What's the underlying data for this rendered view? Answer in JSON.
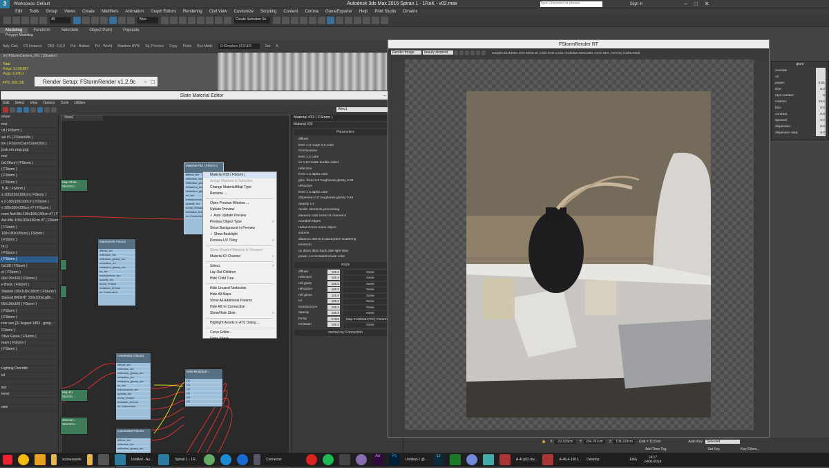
{
  "titlebar": {
    "logo": "3",
    "workspace": "Workspace: Default",
    "title": "Autodesk 3ds Max 2016    Spiran 1 - 1RoK - v02.max",
    "search_placeholder": "Type a keyword or phrase",
    "signin": "Sign In"
  },
  "menu": [
    "Edit",
    "Tools",
    "Group",
    "Views",
    "Create",
    "Modifiers",
    "Animation",
    "Graph Editors",
    "Rendering",
    "Civil View",
    "Customize",
    "Scripting",
    "Content",
    "Corona",
    "GameExporter",
    "Help",
    "Print Studio",
    "Omatrix"
  ],
  "toolbar": {
    "selection_filter": "All",
    "view": "View",
    "named_set": "Create Selection Se"
  },
  "ribbon": {
    "tabs": [
      "Modeling",
      "Freeform",
      "Selection",
      "Object Paint",
      "Populate"
    ],
    "sub": "Polygon Modeling"
  },
  "subtool": [
    "Aply. Calc",
    "FS Instance",
    "OBJ - 0,0,0",
    "Pvt - Bottom",
    "Pvt - World",
    "Random UVW",
    "Sq. Preview",
    "Copy",
    "Paste",
    "Box Mode",
    "D:\\Dropbox (ICI)\\3D\\",
    "Set",
    "A"
  ],
  "viewport": {
    "label": "[+] [FStormCamera_001 ] [Shaded ]",
    "total": "Total",
    "polys": "Polys:  3,169,857",
    "verts": "Verts:  2,470,1",
    "fps": "FPS:    109.168"
  },
  "render_setup": {
    "title": "Render Setup: FStormRender v1.2.9c"
  },
  "slate": {
    "title": "Slate Material Editor",
    "menu": [
      "Edit",
      "Select",
      "View",
      "Options",
      "Tools",
      "Utilities"
    ],
    "view_select": "View1",
    "view_tab": "View1",
    "browser_title": "owser",
    "browser_items": [
      "mat",
      "ult ( FStorm )",
      "set #1 ( FStormMix )",
      "ion ( FStormColorCorrection )",
      "[oak.mix.map.jpg]",
      "mat",
      "0x100cm) ( FStorm )",
      "( FStorm )",
      "( FStorm )",
      "( FStorm )",
      "TUR ( FStorm )",
      "a 100x100x100cm ( FStorm )",
      "x 2 100x100x100cm ( FStorm )",
      "x 100x100x100cm #7 ( FStorm )",
      "rown Ash Mix 100x100x100cm #7 ( FStorm )",
      "Ash Mix 100x100x100cm #7 ( FStorm )",
      "( FStorm )",
      "100x100x100cm) ( FStorm )",
      "( FStorm )",
      "rm )",
      "( FStorm )",
      "( FStorm )",
      "0x100 ( FStorm )",
      "el ( FStorm )",
      "00x100x100 ( FStorm )",
      "e Basic ( FStorm )",
      "Stained 100x100x100cm ( FStorm )",
      "Stained BRIGHT 100x100x1g0h...",
      "00x100x100 ( FStorm )",
      "( FStorm )",
      "( FStorm )",
      "rner sun [31 August 1453 - goog...",
      "FStorm )",
      "Olive Green ( FStorm )",
      "ream ( FStorm )",
      "( FStorm )",
      "",
      "",
      "Lighting Override",
      "ial",
      "",
      "ted",
      "terial",
      "",
      "dow"
    ],
    "nodes": [
      {
        "title": "Material #33 ( FStorm )",
        "slots": [
          "diffuse_tex",
          "reflection_tex",
          "reflection_glossy_tex",
          "refraction_tex",
          "refraction_glossy_tex",
          "ior_tex",
          "translucence_tex",
          "opacity_tex",
          "bump_texture",
          "emission_texture",
          "mr Connection"
        ]
      },
      {
        "title": "Material #8 FStorm",
        "slots": [
          "diffuse_tex",
          "reflection_tex",
          "reflection_glossy_tex",
          "refraction_tex",
          "refraction_glossy_tex",
          "ior_tex",
          "translucence_tex",
          "opacity_tex",
          "bump_texture",
          "emission_texture",
          "mr Connection"
        ]
      },
      {
        "title": "Leaves001 FStorm",
        "slots": [
          "diffuse_tex",
          "reflection_tex",
          "reflection_glossy_tex",
          "refraction_tex",
          "refraction_glossy_tex",
          "ior_tex",
          "translucence_tex",
          "opacity_tex",
          "bump_texture",
          "emission_texture",
          "mr Connection"
        ]
      },
      {
        "title": "Leaves002 FStorm",
        "slots": [
          "diffuse_tex",
          "reflection_tex",
          "reflection_glossy_tex"
        ]
      },
      {
        "title": "vetis Multi/Sub-...",
        "slots": [
          "(1)",
          "(2)",
          "(3)",
          "(4)",
          "(5)",
          "(6)"
        ]
      },
      {
        "title": "Map #145... StormCo...",
        "slots": []
      },
      {
        "title": "Map P1 StormC...",
        "slots": []
      },
      {
        "title": "olorCorr... StormCo...",
        "slots": []
      }
    ],
    "context_menu": [
      {
        "label": "Material #33 ( FStorm )",
        "state": "hl"
      },
      {
        "label": "Assign Material to Selection",
        "state": "dis"
      },
      {
        "label": "Change Material/Map Type",
        "state": ""
      },
      {
        "label": "Rename ...",
        "state": ""
      },
      {
        "label": "-",
        "state": "sep"
      },
      {
        "label": "Open Preview Window ...",
        "state": ""
      },
      {
        "label": "Update Preview",
        "state": ""
      },
      {
        "label": "✓ Auto Update Preview",
        "state": ""
      },
      {
        "label": "Preview Object Type",
        "state": "sub"
      },
      {
        "label": "Show Background in Preview",
        "state": ""
      },
      {
        "label": "✓ Show Backlight",
        "state": ""
      },
      {
        "label": "Preview UV Tiling",
        "state": "sub"
      },
      {
        "label": "-",
        "state": "sep"
      },
      {
        "label": "Show Shaded Material in Viewport",
        "state": "dis"
      },
      {
        "label": "Material ID Channel",
        "state": "sub"
      },
      {
        "label": "-",
        "state": "sep"
      },
      {
        "label": "Select",
        "state": "sub"
      },
      {
        "label": "Lay Out Children",
        "state": ""
      },
      {
        "label": "Hide Child Tree",
        "state": ""
      },
      {
        "label": "-",
        "state": "sep"
      },
      {
        "label": "Hide Unused Nodeslots",
        "state": ""
      },
      {
        "label": "Hide All Maps",
        "state": ""
      },
      {
        "label": "Show All Additional Params",
        "state": ""
      },
      {
        "label": "Hide All mr Connection",
        "state": ""
      },
      {
        "label": "Show/Hide Slots",
        "state": "sub"
      },
      {
        "label": "-",
        "state": "sep"
      },
      {
        "label": "Highlight Assets in ATS Dialog ...",
        "state": ""
      },
      {
        "label": "-",
        "state": "sep"
      },
      {
        "label": "Curve Editor...",
        "state": ""
      },
      {
        "label": "Dope Sheet...",
        "state": ""
      }
    ]
  },
  "param_panel": {
    "header": "Material #33  ( FStorm )",
    "name": "Material #33",
    "rollout": "Parameters",
    "rows": [
      "diffuse",
      "level   1.0  rough  0.0  color",
      "translucence",
      "level   1.0  color",
      "ior   1.53  matte  double sided",
      "reflection",
      "level  1.0  alpha  color",
      "glos. fresn  0.0  roughness  glossy  0.96",
      "refraction",
      "level  1.0  alpha  color",
      "dispersion  0.0  roughness  glossy  0.94",
      "opacity  1.0",
      "render elements processing",
      "element color  transl  id channel  0",
      "rounded edges",
      "radius  0.0cm  same object",
      "volume",
      "distance  300.0cm  absorption  scattering",
      "emission",
      "on  direct illum  back side  light lister",
      "power  1.0  exclude/include  color"
    ],
    "maps_title": "maps",
    "maps": [
      {
        "name": "diffuse",
        "val": "100.0",
        "map": "None"
      },
      {
        "name": "reflection",
        "val": "100.0",
        "map": "None"
      },
      {
        "name": "refl.gloss",
        "val": "100.0",
        "map": "None"
      },
      {
        "name": "refraction",
        "val": "100.0",
        "map": "None"
      },
      {
        "name": "refr.gloss",
        "val": "100.0",
        "map": "None"
      },
      {
        "name": "ior",
        "val": "100.0",
        "map": "None"
      },
      {
        "name": "translucence",
        "val": "100.0",
        "map": "None"
      },
      {
        "name": "opacity",
        "val": "100.0",
        "map": "None"
      },
      {
        "name": "bump",
        "val": "0.004",
        "map": "Map #1459281778  ( FStormMix )"
      },
      {
        "name": "emission",
        "val": "100.0",
        "map": "None"
      }
    ],
    "mr": "mental ray Connection"
  },
  "render_window": {
    "title": "FStormRender RT",
    "render_image": "Render Image",
    "element": "beauty element",
    "stats": "samples 61/10000,  time 02/03:45,  noise level 1.515,  resolution 900x1200,  zoom 84%,  memory 6.22/6.84Gb"
  },
  "glare_panel": {
    "title": "glare",
    "rows": [
      {
        "label": "override",
        "val": ""
      },
      {
        "label": "on",
        "val": ""
      },
      {
        "label": "power:",
        "val": "0.01"
      },
      {
        "label": "size:",
        "val": "0.3"
      },
      {
        "label": "rays number:",
        "val": "6"
      },
      {
        "label": "rotation:",
        "val": "15.0"
      },
      {
        "label": "blur:",
        "val": "0.0"
      },
      {
        "label": "contrast:",
        "val": "0.5"
      },
      {
        "label": "spectral:",
        "val": "0.0"
      },
      {
        "label": "dispersion:",
        "val": "0.0"
      },
      {
        "label": "dispersion step:",
        "val": "5.0"
      }
    ]
  },
  "status": {
    "x": "-22.029cm",
    "y": "254.767cm",
    "z": "108.229cm",
    "grid": "Grid = 10.0cm",
    "autokey": "Auto Key",
    "selected": "Selected",
    "setkey": "Set Key",
    "keyfilters": "Key Filters...",
    "addtime": "Add Time Tag"
  },
  "taskbar": {
    "items": [
      "sceneassets",
      "Untitled - Au...",
      "Spiran 1 - 1R...",
      "Connecter",
      "Untitled-1 @...",
      "A-4t p02.dw...",
      "A-46.4-1001...",
      "Desktop"
    ],
    "lang": "ENG",
    "time": "14:17",
    "date": "14/01/2019"
  },
  "colors": {
    "accent": "#2b7c9e",
    "node": "#9ec0db",
    "selection": "#2d5c8a"
  }
}
